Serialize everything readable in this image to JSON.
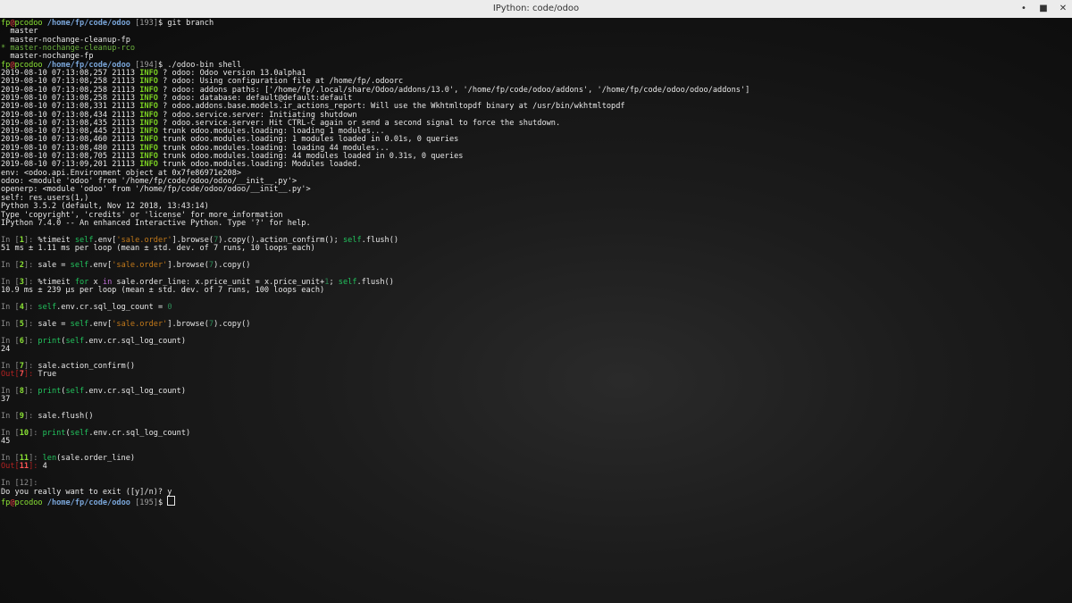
{
  "window": {
    "title": "IPython: code/odoo",
    "controls": {
      "minimize": "•",
      "maximize": "■",
      "close": "✕"
    }
  },
  "prompt": {
    "user": "fp",
    "at": "@",
    "host": "pcodoo",
    "path": "/home/fp/code/odoo"
  },
  "shell": {
    "cmd1": {
      "num": "193",
      "command": "git branch"
    },
    "branches": [
      {
        "marker": " ",
        "name": "master",
        "current": false
      },
      {
        "marker": " ",
        "name": "master-nochange-cleanup-fp",
        "current": false
      },
      {
        "marker": "*",
        "name": "master-nochange-cleanup-rco",
        "current": true
      },
      {
        "marker": " ",
        "name": "master-nochange-fp",
        "current": false
      }
    ],
    "cmd2": {
      "num": "194",
      "command": "./odoo-bin shell"
    },
    "cmd3": {
      "num": "195"
    }
  },
  "logs": [
    {
      "ts": "2019-08-10 07:13:08,257",
      "pid": "21113",
      "level": "INFO",
      "db": "?",
      "logger": "odoo",
      "msg": "Odoo version 13.0alpha1"
    },
    {
      "ts": "2019-08-10 07:13:08,258",
      "pid": "21113",
      "level": "INFO",
      "db": "?",
      "logger": "odoo",
      "msg": "Using configuration file at /home/fp/.odoorc"
    },
    {
      "ts": "2019-08-10 07:13:08,258",
      "pid": "21113",
      "level": "INFO",
      "db": "?",
      "logger": "odoo",
      "msg": "addons paths: ['/home/fp/.local/share/Odoo/addons/13.0', '/home/fp/code/odoo/addons', '/home/fp/code/odoo/odoo/addons']"
    },
    {
      "ts": "2019-08-10 07:13:08,258",
      "pid": "21113",
      "level": "INFO",
      "db": "?",
      "logger": "odoo",
      "msg": "database: default@default:default"
    },
    {
      "ts": "2019-08-10 07:13:08,331",
      "pid": "21113",
      "level": "INFO",
      "db": "?",
      "logger": "odoo.addons.base.models.ir_actions_report",
      "msg": "Will use the Wkhtmltopdf binary at /usr/bin/wkhtmltopdf"
    },
    {
      "ts": "2019-08-10 07:13:08,434",
      "pid": "21113",
      "level": "INFO",
      "db": "?",
      "logger": "odoo.service.server",
      "msg": "Initiating shutdown"
    },
    {
      "ts": "2019-08-10 07:13:08,435",
      "pid": "21113",
      "level": "INFO",
      "db": "?",
      "logger": "odoo.service.server",
      "msg": "Hit CTRL-C again or send a second signal to force the shutdown."
    },
    {
      "ts": "2019-08-10 07:13:08,445",
      "pid": "21113",
      "level": "INFO",
      "db": "trunk",
      "logger": "odoo.modules.loading",
      "msg": "loading 1 modules..."
    },
    {
      "ts": "2019-08-10 07:13:08,460",
      "pid": "21113",
      "level": "INFO",
      "db": "trunk",
      "logger": "odoo.modules.loading",
      "msg": "1 modules loaded in 0.01s, 0 queries"
    },
    {
      "ts": "2019-08-10 07:13:08,480",
      "pid": "21113",
      "level": "INFO",
      "db": "trunk",
      "logger": "odoo.modules.loading",
      "msg": "loading 44 modules..."
    },
    {
      "ts": "2019-08-10 07:13:08,705",
      "pid": "21113",
      "level": "INFO",
      "db": "trunk",
      "logger": "odoo.modules.loading",
      "msg": "44 modules loaded in 0.31s, 0 queries"
    },
    {
      "ts": "2019-08-10 07:13:09,201",
      "pid": "21113",
      "level": "INFO",
      "db": "trunk",
      "logger": "odoo.modules.loading",
      "msg": "Modules loaded."
    }
  ],
  "banner": [
    "env: <odoo.api.Environment object at 0x7fe86971e208>",
    "odoo: <module 'odoo' from '/home/fp/code/odoo/odoo/__init__.py'>",
    "openerp: <module 'odoo' from '/home/fp/code/odoo/odoo/__init__.py'>",
    "self: res.users(1,)",
    "Python 3.5.2 (default, Nov 12 2018, 13:43:14)",
    "Type 'copyright', 'credits' or 'license' for more information",
    "IPython 7.4.0 -- An enhanced Interactive Python. Type '?' for help."
  ],
  "ipy": {
    "in_label": "In [",
    "out_label": "Out[",
    "close": "]: ",
    "c1": {
      "n": "1",
      "magic": "%timeit ",
      "self": "self",
      "a": ".env[",
      "str": "'sale.order'",
      "b": "].browse(",
      "lit": "7",
      "c": ").copy().action_confirm(); ",
      "self2": "self",
      "d": ".flush()",
      "output": "51 ms ± 1.11 ms per loop (mean ± std. dev. of 7 runs, 10 loops each)"
    },
    "c2": {
      "n": "2",
      "pre": "sale = ",
      "self": "self",
      "a": ".env[",
      "str": "'sale.order'",
      "b": "].browse(",
      "lit": "7",
      "c": ").copy()"
    },
    "c3": {
      "n": "3",
      "magic": "%timeit ",
      "for": "for",
      "a": " x ",
      "in": "in",
      "b": " sale.order_line: x.price_unit = x.price_unit+",
      "lit": "1",
      "c": "; ",
      "self": "self",
      "d": ".flush()",
      "output": "10.9 ms ± 239 µs per loop (mean ± std. dev. of 7 runs, 100 loops each)"
    },
    "c4": {
      "n": "4",
      "self": "self",
      "a": ".env.cr.sql_log_count = ",
      "lit": "0"
    },
    "c5": {
      "n": "5",
      "pre": "sale = ",
      "self": "self",
      "a": ".env[",
      "str": "'sale.order'",
      "b": "].browse(",
      "lit": "7",
      "c": ").copy()"
    },
    "c6": {
      "n": "6",
      "fn": "print",
      "a": "(",
      "self": "self",
      "b": ".env.cr.sql_log_count)",
      "output": "24"
    },
    "c7": {
      "n": "7",
      "code": "sale.action_confirm()",
      "out_n": "7",
      "out_val": "True"
    },
    "c8": {
      "n": "8",
      "fn": "print",
      "a": "(",
      "self": "self",
      "b": ".env.cr.sql_log_count)",
      "output": "37"
    },
    "c9": {
      "n": "9",
      "code": "sale.flush()"
    },
    "c10": {
      "n": "10",
      "fn": "print",
      "a": "(",
      "self": "self",
      "b": ".env.cr.sql_log_count)",
      "output": "45"
    },
    "c11": {
      "n": "11",
      "fn": "len",
      "b": "(sale.order_line)",
      "out_n": "11",
      "out_val": "4"
    },
    "c12": {
      "n": "12",
      "suffix": ":"
    }
  },
  "exit_prompt": "Do you really want to exit ([y]/n)? y"
}
